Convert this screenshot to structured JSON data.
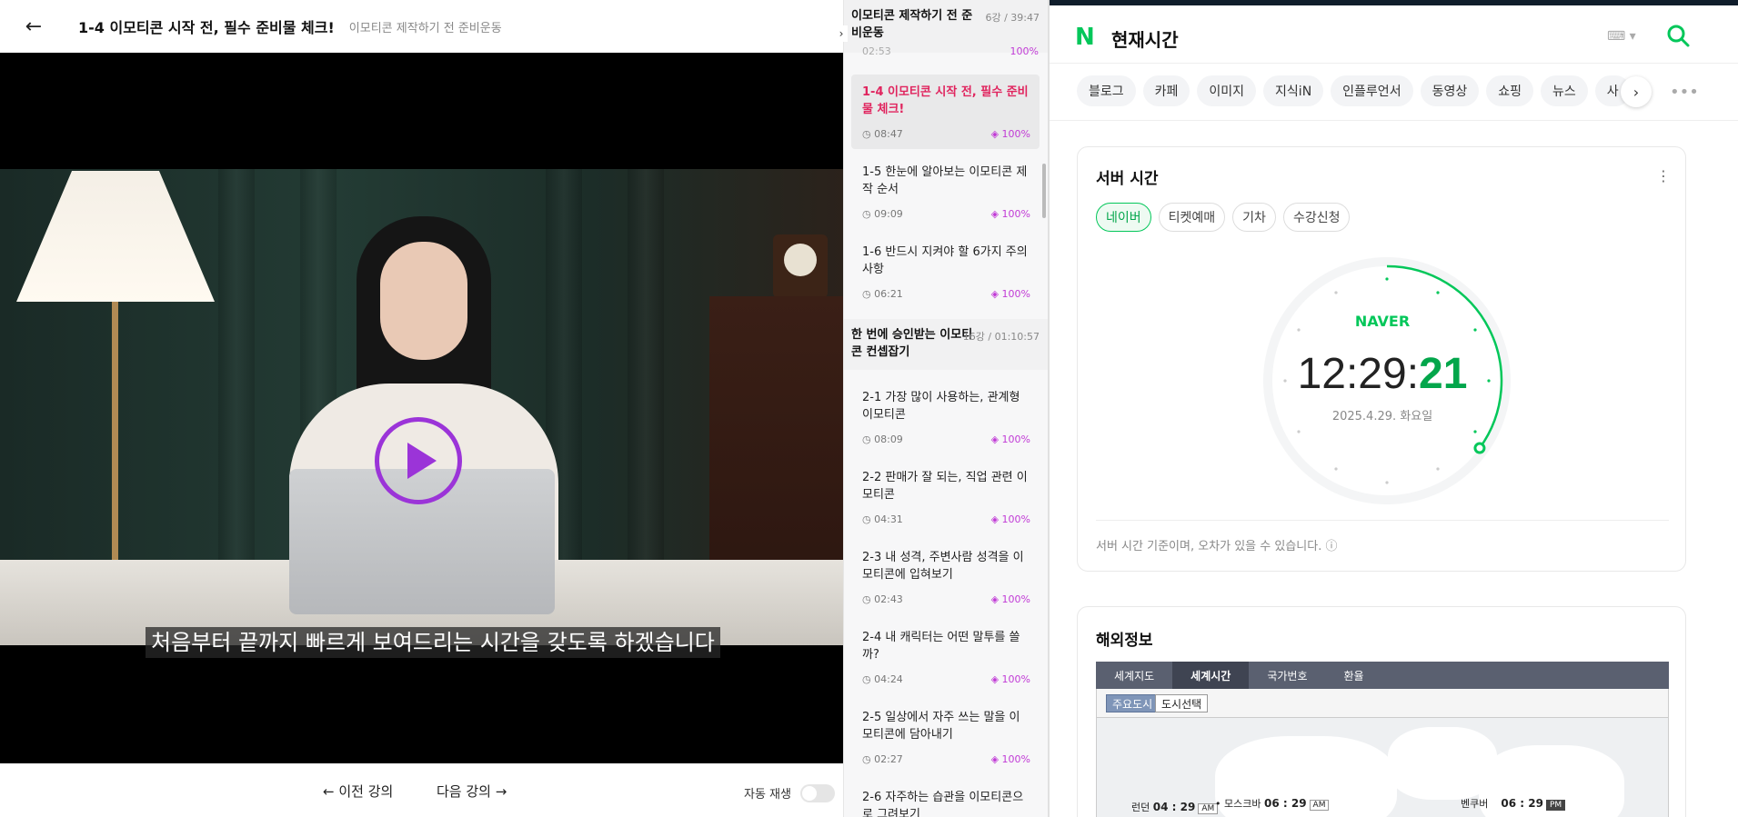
{
  "lecture": {
    "title": "1-4 이모티콘 시작 전, 필수 준비물 체크!",
    "subtitle": "이모티콘 제작하기 전 준비운동",
    "caption": "처음부터 끝까지 빠르게 보여드리는 시간을 갖도록 하겠습니다",
    "prev_label": "← 이전 강의",
    "next_label": "다음 강의 →",
    "autoplay_label": "자동 재생",
    "autoplay_on": false
  },
  "playlist": {
    "sections": [
      {
        "title": "이모티콘 제작하기 전 준비운동",
        "meta": "6강 / 39:47"
      },
      {
        "title": "한 번에 승인받는 이모티콘 컨셉잡기",
        "meta": "16강 / 01:10:57"
      }
    ],
    "partial_duration": "02:53",
    "partial_progress": "100%",
    "lessons": [
      {
        "title": "1-4 이모티콘 시작 전, 필수 준비물 체크!",
        "duration": "08:47",
        "progress": "100%"
      },
      {
        "title": "1-5 한눈에 알아보는 이모티콘 제작 순서",
        "duration": "09:09",
        "progress": "100%"
      },
      {
        "title": "1-6 반드시 지켜야 할 6가지 주의사항",
        "duration": "06:21",
        "progress": "100%"
      },
      {
        "title": "2-1 가장 많이 사용하는, 관계형 이모티콘",
        "duration": "08:09",
        "progress": "100%"
      },
      {
        "title": "2-2 판매가 잘 되는, 직업 관련 이모티콘",
        "duration": "04:31",
        "progress": "100%"
      },
      {
        "title": "2-3 내 성격, 주변사람 성격을 이모티콘에 입혀보기",
        "duration": "02:43",
        "progress": "100%"
      },
      {
        "title": "2-4 내 캐릭터는 어떤 말투를 쓸까?",
        "duration": "04:24",
        "progress": "100%"
      },
      {
        "title": "2-5 일상에서 자주 쓰는 말을 이모티콘에 담아내기",
        "duration": "02:27",
        "progress": "100%"
      },
      {
        "title": "2-6 자주하는 습관을 이모티콘으로 그려보기",
        "duration": "",
        "progress": ""
      }
    ]
  },
  "naver": {
    "logo": "N",
    "query": "현재시간",
    "tabs": [
      "블로그",
      "카페",
      "이미지",
      "지식iN",
      "인플루언서",
      "동영상",
      "쇼핑",
      "뉴스",
      "사"
    ],
    "server_card": {
      "title": "서버 시간",
      "chips": [
        "네이버",
        "티켓예매",
        "기차",
        "수강신청"
      ],
      "active_chip": "네이버",
      "brand": "NAVER",
      "time_hm": "12:29:",
      "time_s": "21",
      "seconds": 21,
      "date": "2025.4.29. 화요일",
      "note": "서버 시간 기준이며, 오차가 있을 수 있습니다. ⓘ"
    },
    "world_card": {
      "title": "해외정보",
      "tabs": [
        "세계지도",
        "세계시간",
        "국가번호",
        "환율"
      ],
      "active_tab": "세계시간",
      "subtabs": [
        "주요도시",
        "도시선택"
      ],
      "cities": [
        {
          "name": "런던",
          "time": "04 : 29",
          "ampm": "AM"
        },
        {
          "name": "모스크바",
          "time": "06 : 29",
          "ampm": "AM"
        },
        {
          "name": "벤쿠버",
          "time": "06 : 29",
          "ampm": "PM"
        }
      ]
    },
    "colors": {
      "brand": "#03c75a",
      "accent_pink": "#e0245e",
      "progress_purple": "#c13bd6",
      "play_purple": "#9b34d8"
    }
  }
}
